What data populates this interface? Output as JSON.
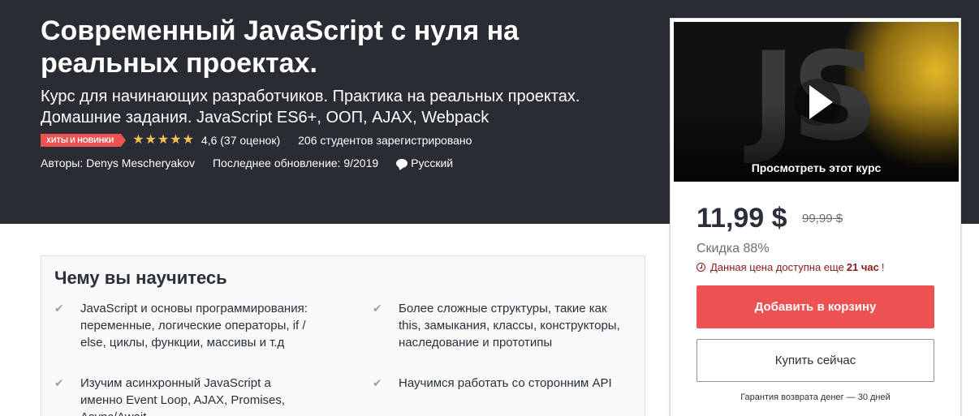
{
  "course": {
    "title": "Современный JavaScript с нуля на реальных проектах.",
    "subtitle": "Курс для начинающих разработчиков. Практика на реальных проектах. Домашние задания. JavaScript ES6+, ООП, AJAX, Webpack",
    "badge": "ХИТЫ И НОВИНКИ",
    "rating_value": 4.6,
    "rating_text": "4,6 (37 оценок)",
    "students": "206 студентов зарегистрировано",
    "authors": "Авторы: Denys Mescheryakov",
    "updated": "Последнее обновление: 9/2019",
    "language": "Русский"
  },
  "learn": {
    "title": "Чему вы научитесь",
    "items": [
      "JavaScript и основы программирования: переменные, логические операторы, if / else, циклы, функции, массивы и т.д",
      "Более сложные структуры, такие как this, замыкания, классы, конструкторы, наследование и прототипы",
      "Изучим асинхронный JavaScript а именно Event Loop, AJAX, Promises, Async/Await",
      "Научимся работать со сторонним API"
    ]
  },
  "sidebar": {
    "preview_label": "Просмотреть этот курс",
    "preview_logo": "JS",
    "price": "11,99 $",
    "old_price": "99,99 $",
    "discount": "Скидка 88%",
    "timer_prefix": "Данная цена доступна еще",
    "timer_value": "21 час",
    "timer_suffix": "!",
    "cart_button": "Добавить в корзину",
    "buy_button": "Купить сейчас",
    "guarantee": "Гарантия возврата денег — 30 дней"
  },
  "colors": {
    "hero_bg": "#2a2c33",
    "accent_red": "#ec5252",
    "star": "#f4c150",
    "timer_red": "#8a1b1b"
  },
  "icons": [
    "star-icon",
    "speech-bubble-icon",
    "check-icon",
    "play-icon",
    "alarm-clock-icon"
  ]
}
